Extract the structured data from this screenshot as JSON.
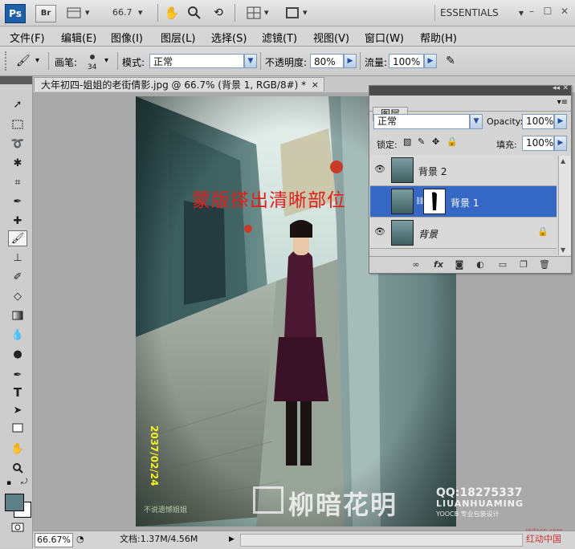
{
  "appbar": {
    "ps_logo": "Ps",
    "br_logo": "Br",
    "zoom": "66.7",
    "workspace": "ESSENTIALS"
  },
  "menu": [
    "文件(F)",
    "编辑(E)",
    "图像(I)",
    "图层(L)",
    "选择(S)",
    "滤镜(T)",
    "视图(V)",
    "窗口(W)",
    "帮助(H)"
  ],
  "options": {
    "brush_label": "画笔:",
    "brush_size": "34",
    "mode_label": "模式:",
    "mode_value": "正常",
    "opacity_label": "不透明度:",
    "opacity_value": "80%",
    "flow_label": "流量:",
    "flow_value": "100%"
  },
  "document": {
    "tab_title": "大年初四-姐姐的老街倩影.jpg @ 66.7% (背景 1, RGB/8#) *",
    "close": "×",
    "annotation": "蒙版搽出清晰部位",
    "date_stamp": "2037/02/24",
    "watermark_logo": "柳暗花明",
    "watermark_qq": "QQ:18275337",
    "watermark_pinyin": "LIUANHUAMING",
    "watermark_studio": "YOOCB 专业包装设计",
    "watermark_small": "不说遗憾姐姐",
    "site_watermark": "redocn.com",
    "site_name": "红动中国",
    "colors": {
      "annotation": "#e0201a",
      "date": "#f5f020"
    }
  },
  "status": {
    "zoom": "66.67%",
    "doc_info": "文档:1.37M/4.56M"
  },
  "layers_panel": {
    "tab": "图层",
    "blend_mode": "正常",
    "opacity_label": "Opacity:",
    "opacity_value": "100%",
    "lock_label": "锁定:",
    "fill_label": "填充:",
    "fill_value": "100%",
    "layers": [
      {
        "name": "背景 2",
        "selected": false,
        "has_mask": false,
        "locked": false
      },
      {
        "name": "背景 1",
        "selected": true,
        "has_mask": true,
        "locked": false
      },
      {
        "name": "背景",
        "selected": false,
        "has_mask": false,
        "locked": true
      }
    ],
    "bottom_icons": [
      "link-icon",
      "fx-icon",
      "mask-icon",
      "adjustment-icon",
      "group-icon",
      "new-layer-icon",
      "trash-icon"
    ]
  }
}
